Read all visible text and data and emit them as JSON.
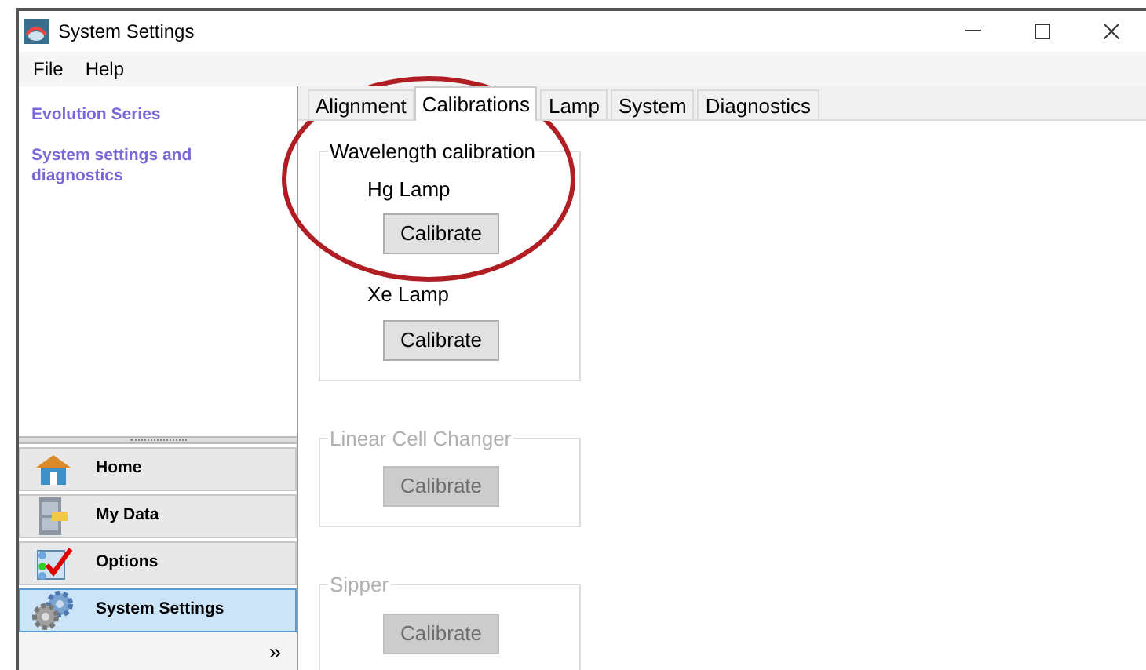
{
  "window": {
    "title": "System Settings"
  },
  "menu": [
    "File",
    "Help"
  ],
  "sidebar": {
    "links": [
      "Evolution Series",
      "System settings and diagnostics"
    ],
    "nav_items": [
      {
        "label": "Home",
        "selected": false
      },
      {
        "label": "My Data",
        "selected": false
      },
      {
        "label": "Options",
        "selected": false
      },
      {
        "label": "System Settings",
        "selected": true
      }
    ],
    "expand": "»"
  },
  "tabs": [
    {
      "label": "Alignment",
      "selected": false
    },
    {
      "label": "Calibrations",
      "selected": true
    },
    {
      "label": "Lamp",
      "selected": false
    },
    {
      "label": "System",
      "selected": false
    },
    {
      "label": "Diagnostics",
      "selected": false
    }
  ],
  "groups": [
    {
      "title": "Wavelength calibration",
      "disabled": false,
      "items": [
        {
          "label": "Hg Lamp",
          "button": "Calibrate"
        },
        {
          "label": "Xe Lamp",
          "button": "Calibrate"
        }
      ]
    },
    {
      "title": "Linear Cell Changer",
      "disabled": true,
      "items": [
        {
          "button": "Calibrate"
        }
      ]
    },
    {
      "title": "Sipper",
      "disabled": true,
      "items": [
        {
          "button": "Calibrate"
        }
      ]
    }
  ],
  "annotation": {
    "kind": "ellipse",
    "color": "#b01e23"
  }
}
